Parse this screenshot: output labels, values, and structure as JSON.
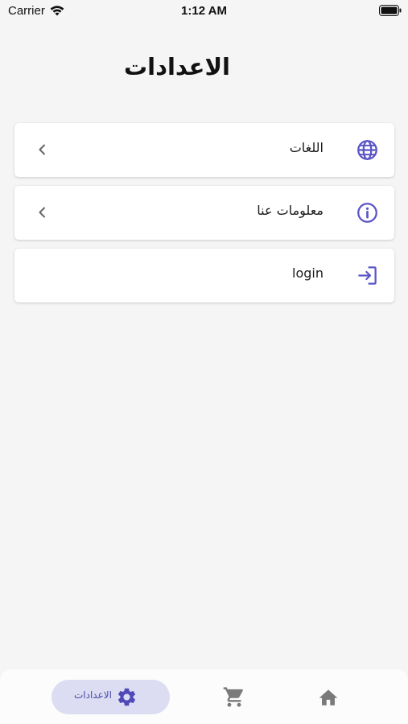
{
  "status_bar": {
    "carrier": "Carrier",
    "time": "1:12 AM"
  },
  "page": {
    "title": "الاعدادات"
  },
  "menu": {
    "items": [
      {
        "label": "اللغات",
        "icon": "globe-icon",
        "has_chevron": true
      },
      {
        "label": "معلومات عنا",
        "icon": "info-icon",
        "has_chevron": true
      },
      {
        "label": "login",
        "icon": "login-icon",
        "has_chevron": false
      }
    ]
  },
  "bottom_nav": {
    "items": [
      {
        "label": "الاعدادات",
        "icon": "gear-icon",
        "active": true
      },
      {
        "label": "",
        "icon": "cart-icon",
        "active": false
      },
      {
        "label": "",
        "icon": "home-icon",
        "active": false
      }
    ]
  },
  "colors": {
    "accent": "#5a55c6",
    "background": "#f5f5f5",
    "card": "#ffffff",
    "nav_active_bg": "#dcdcf2",
    "inactive_icon": "#7a7a7a"
  }
}
